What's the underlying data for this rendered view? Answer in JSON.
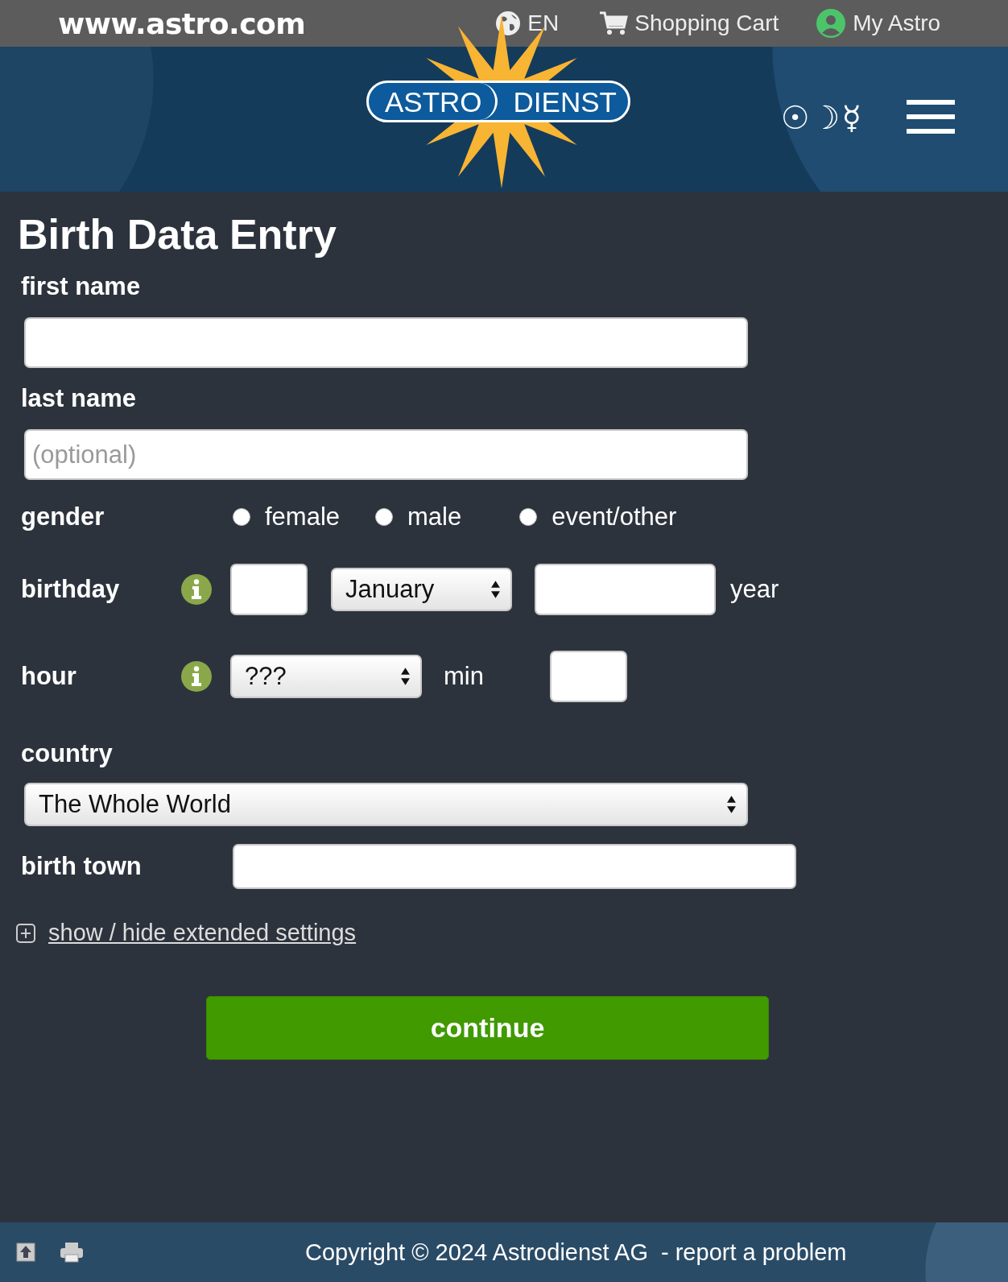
{
  "top_bar": {
    "site": "www.astro.com",
    "language": "EN",
    "cart": "Shopping Cart",
    "account": "My Astro"
  },
  "header": {
    "logo": [
      "ASTRO",
      "DIENST"
    ],
    "symbols": "☉☽☿"
  },
  "form": {
    "title": "Birth Data Entry",
    "first_name": {
      "label": "first name"
    },
    "last_name": {
      "label": "last name",
      "placeholder": "(optional)"
    },
    "gender": {
      "label": "gender",
      "options": [
        {
          "label": "female",
          "selected": false
        },
        {
          "label": "male",
          "selected": false
        },
        {
          "label": "event/other",
          "selected": false
        }
      ]
    },
    "birthday": {
      "label": "birthday",
      "month": "January",
      "year_label": "year"
    },
    "hour": {
      "label": "hour",
      "hour_value": "???",
      "min_label": "min"
    },
    "country": {
      "label": "country",
      "value": "The Whole World"
    },
    "birth_town": {
      "label": "birth town"
    },
    "extended_link": "show / hide extended settings",
    "submit": "continue"
  },
  "footer": {
    "copyright": "Copyright © 2024 Astrodienst AG",
    "report": "- report a problem"
  }
}
